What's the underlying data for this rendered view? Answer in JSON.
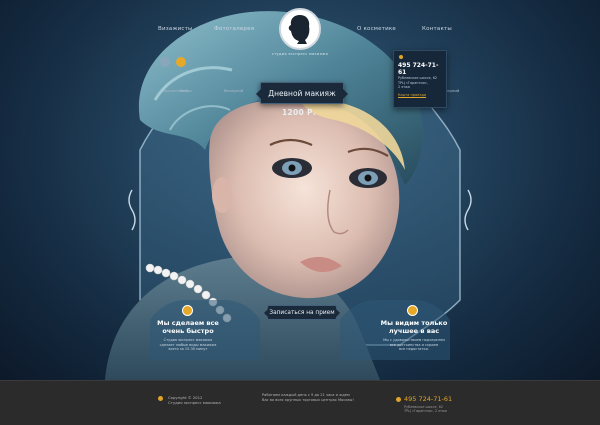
{
  "nav": {
    "item1": "Визажисты",
    "item2": "Фотогалерея",
    "item3": "О косметике",
    "item4": "Контакты"
  },
  "logo": {
    "caption": "студия экспресс макияжа"
  },
  "service": {
    "name": "Дневной макияж",
    "price": "1200 Р."
  },
  "contact_card": {
    "phone": "495 724-71-61",
    "address_line1": "Рублевское шоссе, 62",
    "address_line2": "ТРЦ «Гарантия»,",
    "address_line3": "2 этаж",
    "map_link": "Карта проезда"
  },
  "side_labels": {
    "left1": "Классический",
    "left2": "Ретро",
    "left3": "Вечерний",
    "right1": "Вечерний"
  },
  "features": {
    "left_title_1": "Мы сделаем все",
    "left_title_2": "очень быстро",
    "left_text_1": "Студия экспресс макияжа",
    "left_text_2": "сделает любые виды макияжа",
    "left_text_3": "всего за 15-30 минут",
    "right_title_1": "Мы видим только",
    "right_title_2": "лучшее в вас",
    "right_text_1": "Мы с удовольствием подчеркнем",
    "right_text_2": "все достоинства и скроем",
    "right_text_3": "все недостатки."
  },
  "signup": {
    "label": "Записаться на прием"
  },
  "footer": {
    "copyright_1": "Copyright © 2012",
    "copyright_2": "Студия экспресс макияжа",
    "hours_1": "Работаем каждый день с 9 до 21 часа и ждем",
    "hours_2": "Вас во всех крупных торговых центрах Москвы!",
    "phone": "495 724-71-61",
    "addr_1": "Рублевское шоссе, 62",
    "addr_2": "ТРЦ «Гарантия», 2 этаж"
  },
  "colors": {
    "accent": "#e0a42a",
    "background": "#24445f",
    "footer": "#2b2b2b"
  }
}
